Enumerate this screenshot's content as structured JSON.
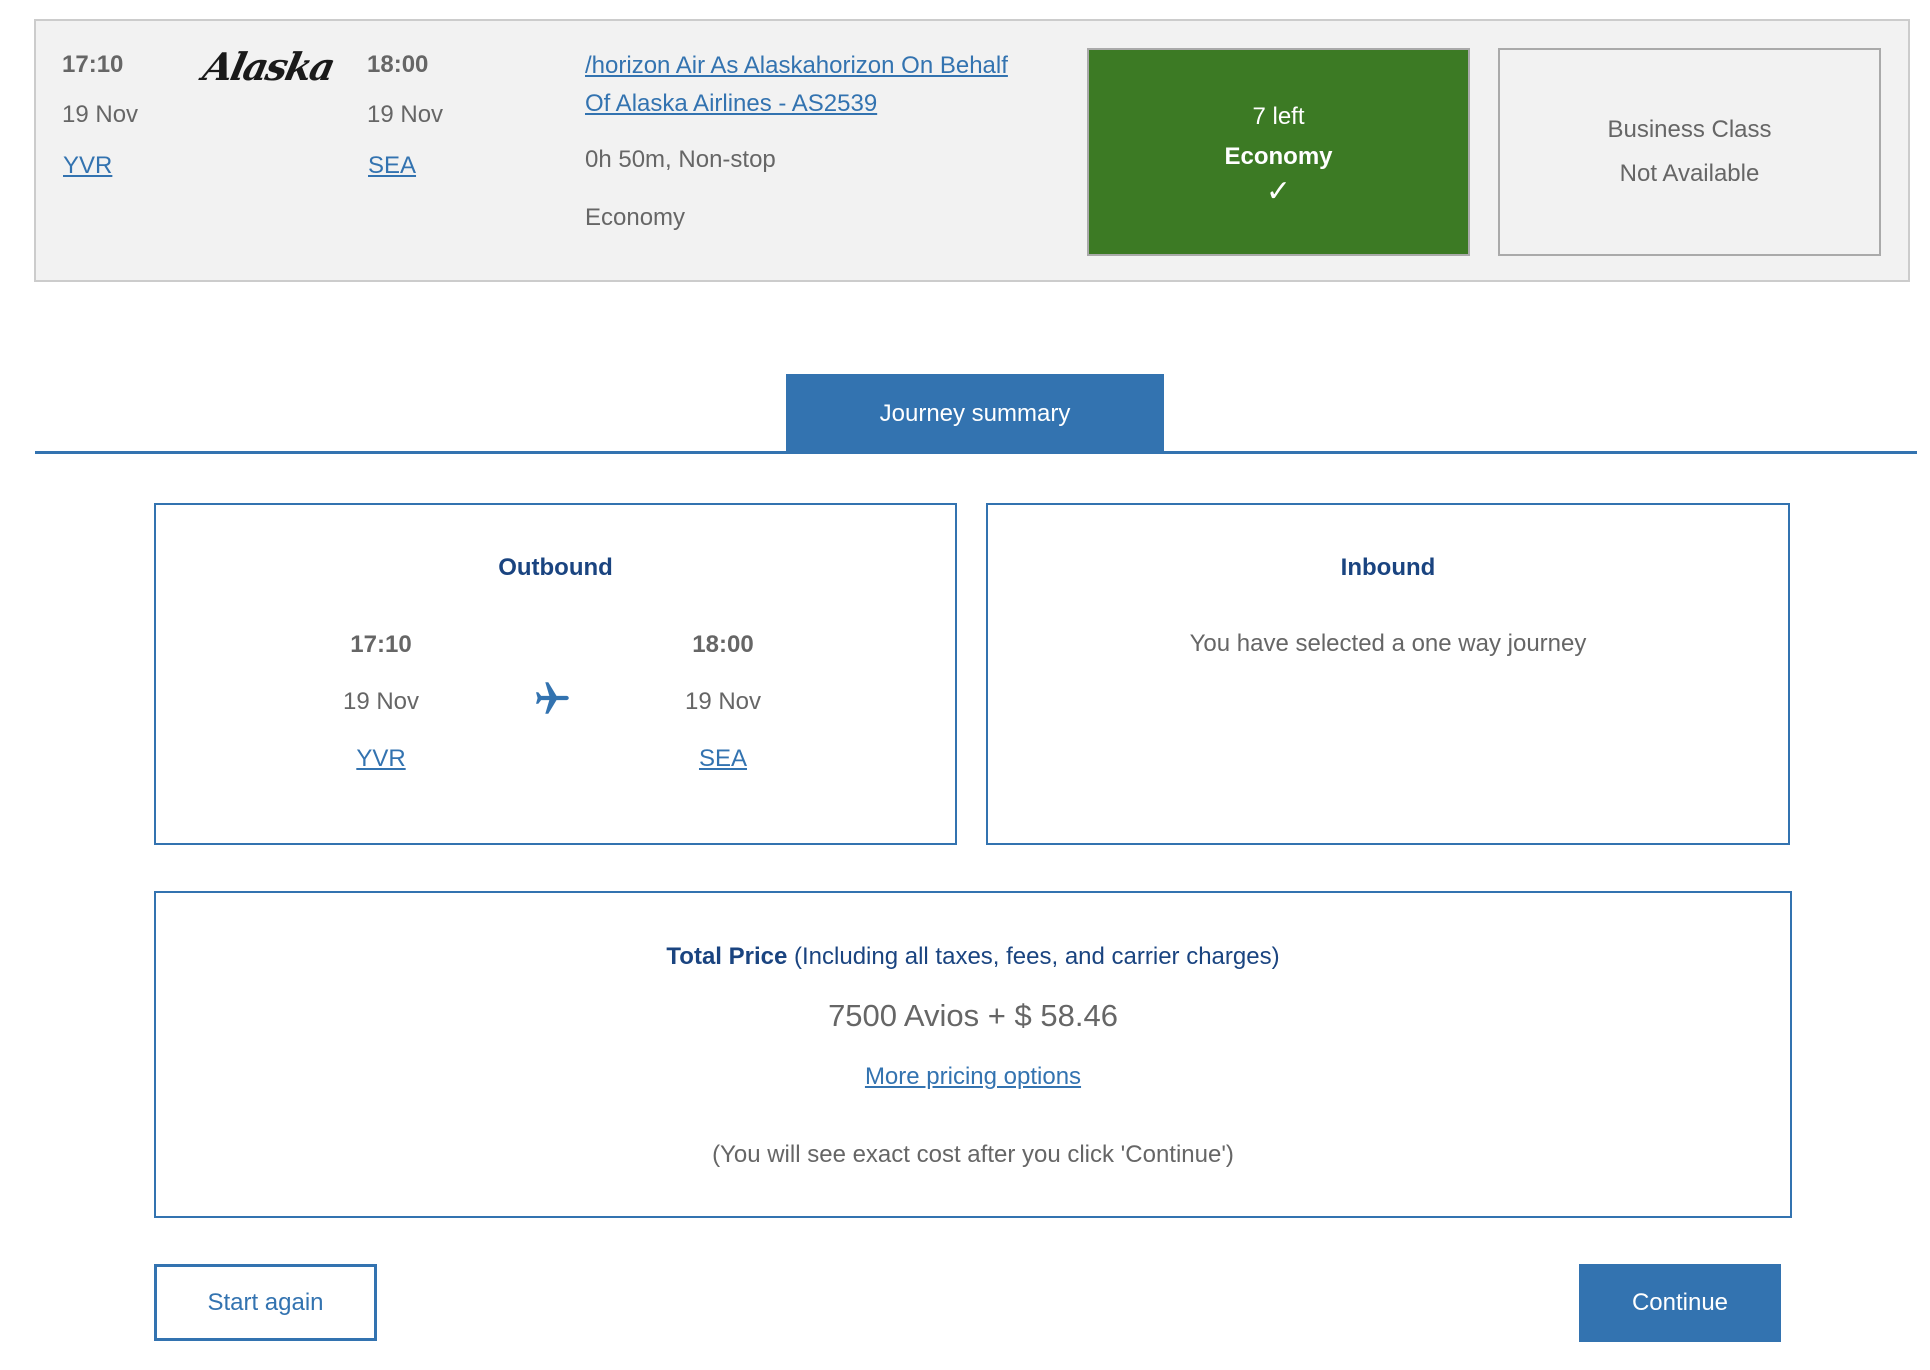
{
  "flight": {
    "departure": {
      "time": "17:10",
      "date": "19 Nov",
      "airport": "YVR"
    },
    "arrival": {
      "time": "18:00",
      "date": "19 Nov",
      "airport": "SEA"
    },
    "airline_logo": "Alaska",
    "flight_link_line1": "/horizon Air As Alaskahorizon On Behalf",
    "flight_link_line2": "Of Alaska Airlines - AS2539",
    "duration": "0h 50m, Non-stop",
    "cabin": "Economy",
    "options": {
      "economy": {
        "availability": "7 left",
        "label": "Economy",
        "selected_icon": "check-icon",
        "color": "#3c7a24"
      },
      "business": {
        "line1": "Business Class",
        "line2": "Not Available"
      }
    }
  },
  "tab": {
    "label": "Journey summary",
    "color": "#3373b0"
  },
  "outbound": {
    "title": "Outbound",
    "departure": {
      "time": "17:10",
      "date": "19 Nov",
      "airport": "YVR"
    },
    "arrival": {
      "time": "18:00",
      "date": "19 Nov",
      "airport": "SEA"
    },
    "icon": "plane-icon"
  },
  "inbound": {
    "title": "Inbound",
    "message": "You have selected a one way journey"
  },
  "price": {
    "heading_bold": "Total Price",
    "heading_rest": " (Including all taxes, fees, and carrier charges)",
    "value": "7500 Avios + $ 58.46",
    "more_link": "More pricing options",
    "note": "(You will see exact cost after you click 'Continue')"
  },
  "buttons": {
    "start_again": "Start again",
    "continue": "Continue"
  }
}
